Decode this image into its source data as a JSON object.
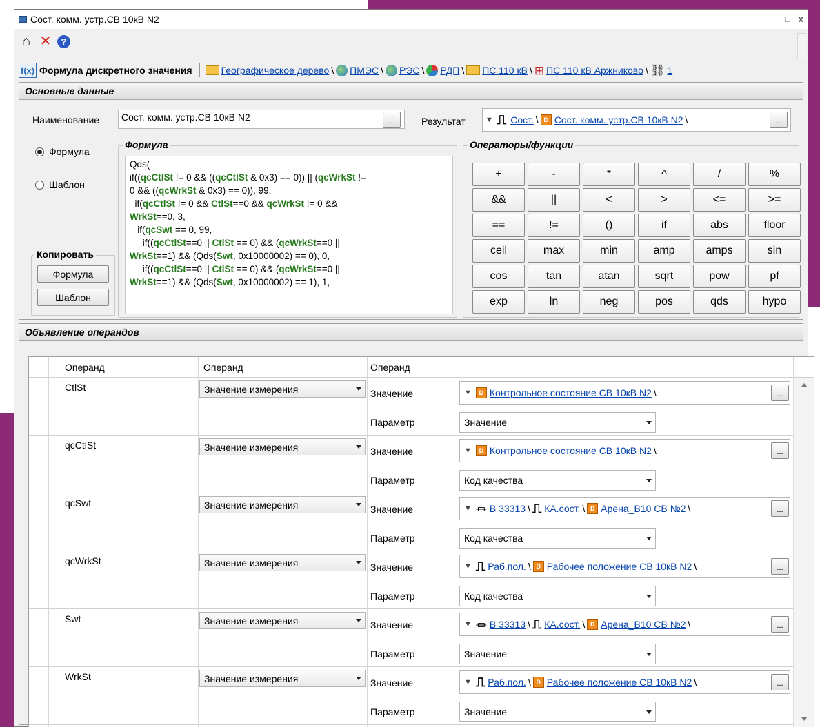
{
  "window": {
    "title": "Сост. комм. устр.СВ 10кВ N2",
    "controls": [
      "_",
      "□",
      "x"
    ]
  },
  "breadcrumb": {
    "title": "Формула дискретного значения",
    "items": [
      {
        "label": "Географическое дерево",
        "icon": "folder-icon"
      },
      {
        "label": "ПМЭС",
        "icon": "globe-icon"
      },
      {
        "label": "РЭС",
        "icon": "globe-icon"
      },
      {
        "label": "РДП",
        "icon": "pie-icon"
      },
      {
        "label": "ПС 110 кВ",
        "icon": "folder-icon"
      },
      {
        "label": "ПС 110 кВ Аржниково",
        "icon": "substation-icon"
      },
      {
        "label": "1",
        "icon": "node-icon"
      }
    ]
  },
  "main": {
    "section_title": "Основные данные",
    "name_label": "Наименование",
    "name_value": "Сост. комм. устр.СВ 10кВ N2",
    "result_label": "Результат",
    "result_ref": {
      "part1": "Сост.",
      "part2": "Сост. комм. устр.СВ 10кВ N2"
    },
    "radio_formula": "Формула",
    "radio_template": "Шаблон",
    "formula_group": "Формула",
    "ops_group": "Операторы/функции",
    "copy_group": "Копировать",
    "copy_formula_btn": "Формула",
    "copy_template_btn": "Шаблон",
    "operators": [
      "+",
      "-",
      "*",
      "^",
      "/",
      "%",
      "&&",
      "||",
      "<",
      ">",
      "<=",
      ">=",
      "==",
      "!=",
      "()",
      "if",
      "abs",
      "floor",
      "ceil",
      "max",
      "min",
      "amp",
      "amps",
      "sin",
      "cos",
      "tan",
      "atan",
      "sqrt",
      "pow",
      "pf",
      "exp",
      "ln",
      "neg",
      "pos",
      "qds",
      "hypo"
    ]
  },
  "operands": {
    "section_title": "Объявление операндов",
    "headers": [
      "Операнд",
      "Операнд",
      "Операнд"
    ],
    "key_value": "Значение",
    "key_param": "Параметр",
    "rows": [
      {
        "name": "CtlSt",
        "type": "Значение измерения",
        "ref_a": "",
        "ref_b": "",
        "ref_c": "Контрольное состояние СВ 10кВ N2",
        "param": "Значение"
      },
      {
        "name": "qcCtlSt",
        "type": "Значение измерения",
        "ref_a": "",
        "ref_b": "",
        "ref_c": "Контрольное состояние СВ 10кВ N2",
        "param": "Код качества"
      },
      {
        "name": "qcSwt",
        "type": "Значение измерения",
        "ref_a": "В 33313",
        "ref_b": "КА.сост.",
        "ref_c": "Арена_В10 СВ №2",
        "param": "Код качества"
      },
      {
        "name": "qcWrkSt",
        "type": "Значение измерения",
        "ref_a": "",
        "ref_b": "Раб.пол.",
        "ref_c": "Рабочее положение СВ 10кВ N2",
        "param": "Код качества"
      },
      {
        "name": "Swt",
        "type": "Значение измерения",
        "ref_a": "В 33313",
        "ref_b": "КА.сост.",
        "ref_c": "Арена_В10 СВ №2",
        "param": "Значение"
      },
      {
        "name": "WrkSt",
        "type": "Значение измерения",
        "ref_a": "",
        "ref_b": "Раб.пол.",
        "ref_c": "Рабочее положение СВ 10кВ N2",
        "param": "Значение"
      }
    ]
  }
}
